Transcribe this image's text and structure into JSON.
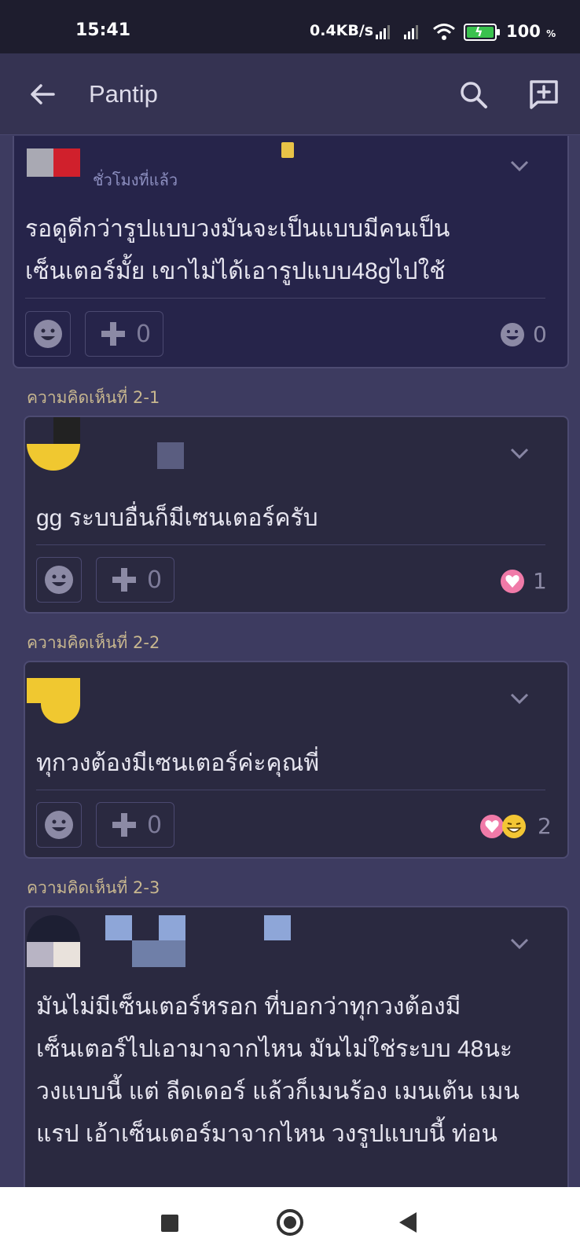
{
  "status_bar": {
    "time": "15:41",
    "net_speed": "0.4KB/s",
    "battery": "100",
    "battery_unit": "%"
  },
  "app_bar": {
    "title": "Pantip",
    "back_icon": "arrow-left-icon",
    "search_icon": "search-icon",
    "new_post_icon": "new-post-icon"
  },
  "comments": [
    {
      "label": "",
      "timestamp": "ชั่วโมงที่แล้ว",
      "text_lines": [
        "รอดูดีกว่ารูปแบบวงมันจะเป็นแบบมีคนเป็น",
        "เซ็นเตอร์มั้ย เขาไม่ได้เอารูปแบบ48gไปใช้"
      ],
      "plus_count": "0",
      "reaction_count": "0"
    },
    {
      "label": "ความคิดเห็นที่ 2-1",
      "text_lines": [
        "gg ระบบอื่นก็มีเซนเตอร์ครับ"
      ],
      "plus_count": "0",
      "reaction_count": "1"
    },
    {
      "label": "ความคิดเห็นที่ 2-2",
      "text_lines": [
        "ทุกวงต้องมีเซนเตอร์ค่ะคุณพี่"
      ],
      "plus_count": "0",
      "reaction_count": "2"
    },
    {
      "label": "ความคิดเห็นที่ 2-3",
      "text_lines": [
        "มันไม่มีเซ็นเตอร์หรอก ที่บอกว่าทุกวงต้องมี",
        "เซ็นเตอร์ไปเอามาจากไหน มันไม่ใช่ระบบ 48นะ",
        "วงแบบนี้ แต่ ลีดเดอร์ แล้วก็เมนร้อง เมนเต้น เมน",
        "แรป เอ้าเซ็นเตอร์มาจากไหน วงรูปแบบนี้ ท่อน"
      ]
    }
  ],
  "colors": {
    "background": "#3d3b60",
    "card": "#2a2940",
    "accent_label": "#c8b78f"
  }
}
